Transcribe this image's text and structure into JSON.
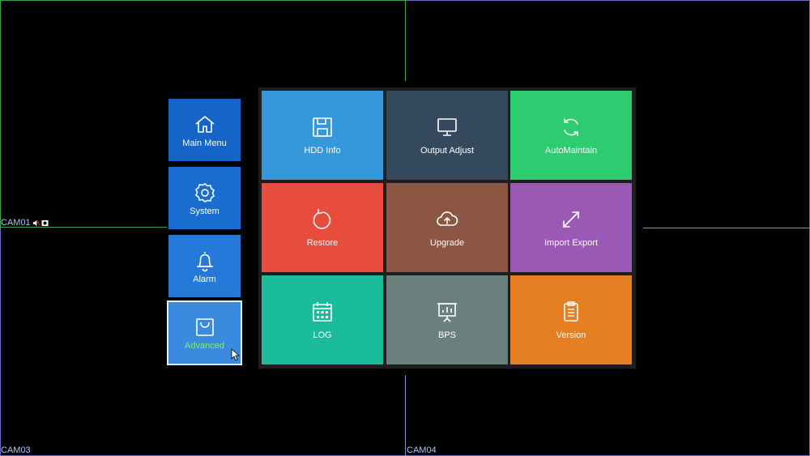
{
  "cameras": {
    "cam01": "CAM01",
    "cam03": "CAM03",
    "cam04": "CAM04"
  },
  "sidebar": {
    "items": [
      {
        "label": "Main Menu",
        "icon": "home-icon"
      },
      {
        "label": "System",
        "icon": "gear-icon"
      },
      {
        "label": "Alarm",
        "icon": "bell-icon"
      },
      {
        "label": "Advanced",
        "icon": "bag-icon",
        "selected": true
      }
    ]
  },
  "grid": {
    "tiles": [
      {
        "label": "HDD Info",
        "icon": "floppy-disk-icon",
        "color": "#3498db"
      },
      {
        "label": "Output Adjust",
        "icon": "monitor-icon",
        "color": "#34495e"
      },
      {
        "label": "AutoMaintain",
        "icon": "refresh-icon",
        "color": "#2ecc71"
      },
      {
        "label": "Restore",
        "icon": "restore-icon",
        "color": "#e74c3c"
      },
      {
        "label": "Upgrade",
        "icon": "cloud-upload-icon",
        "color": "#8d5543"
      },
      {
        "label": "Import Export",
        "icon": "expand-arrows-icon",
        "color": "#9b59b6"
      },
      {
        "label": "LOG",
        "icon": "calendar-icon",
        "color": "#1abc9c"
      },
      {
        "label": "BPS",
        "icon": "presentation-chart-icon",
        "color": "#6b7f7c"
      },
      {
        "label": "Version",
        "icon": "clipboard-icon",
        "color": "#e67e22"
      }
    ]
  },
  "colors": {
    "sidebar_blue": "#1a6fd1",
    "selected_label": "#7df06a",
    "grid_green": "#3aa64a",
    "grid_purple": "#8a8ad0"
  }
}
